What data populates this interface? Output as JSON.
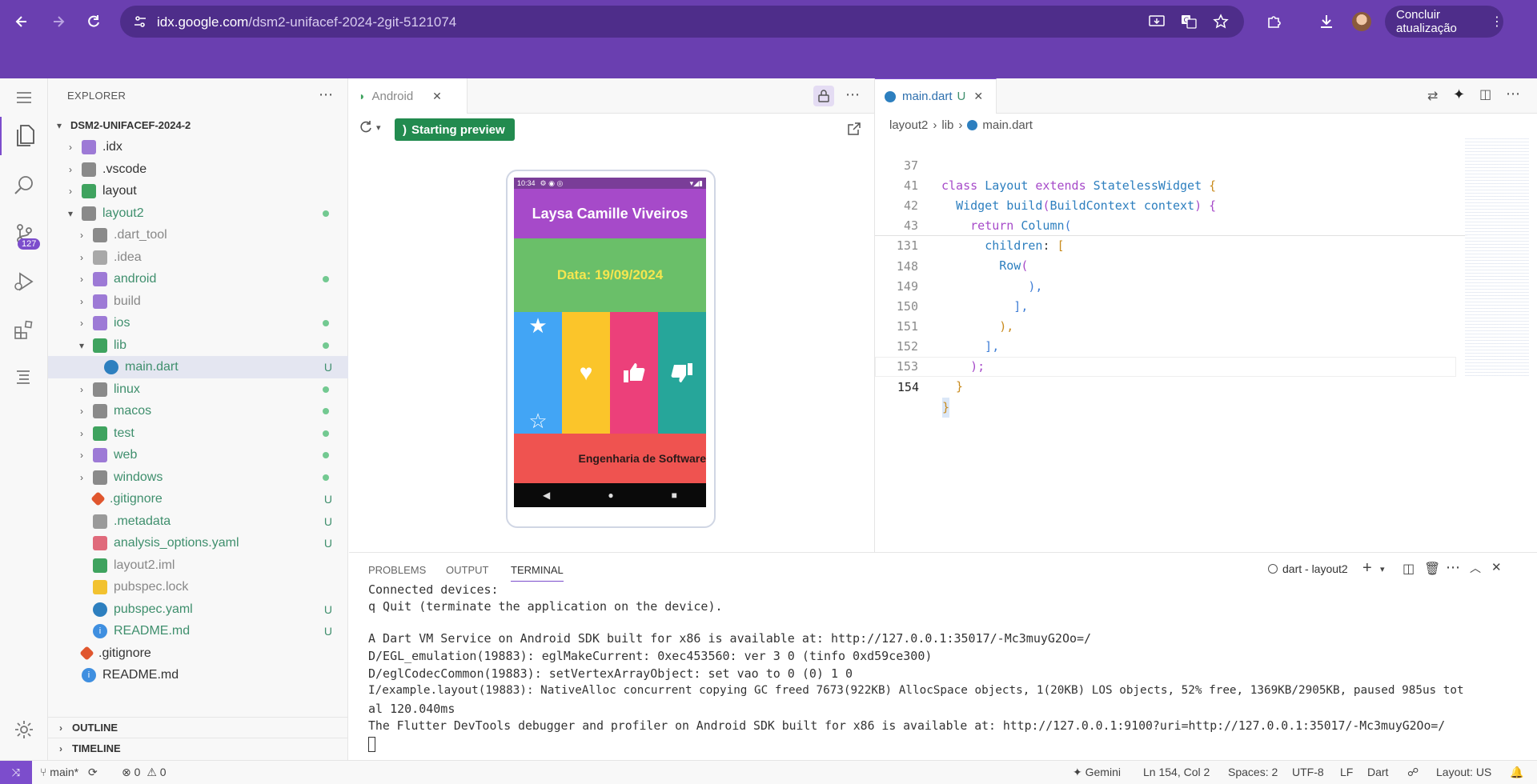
{
  "browser": {
    "url_host": "idx.google.com",
    "url_path": "/dsm2-unifacef-2024-2git-5121074",
    "update_button": "Concluir atualização"
  },
  "activity": {
    "scm_badge": "127"
  },
  "explorer": {
    "title": "EXPLORER",
    "root": "DSM2-UNIFACEF-2024-2",
    "items": [
      {
        "name": ".idx",
        "status": ""
      },
      {
        "name": ".vscode",
        "status": ""
      },
      {
        "name": "layout",
        "status": ""
      },
      {
        "name": "layout2",
        "status": "dot"
      },
      {
        "name": ".dart_tool",
        "status": ""
      },
      {
        "name": ".idea",
        "status": ""
      },
      {
        "name": "android",
        "status": "dot"
      },
      {
        "name": "build",
        "status": ""
      },
      {
        "name": "ios",
        "status": "dot"
      },
      {
        "name": "lib",
        "status": "dot"
      },
      {
        "name": "main.dart",
        "status": "U"
      },
      {
        "name": "linux",
        "status": "dot"
      },
      {
        "name": "macos",
        "status": "dot"
      },
      {
        "name": "test",
        "status": "dot"
      },
      {
        "name": "web",
        "status": "dot"
      },
      {
        "name": "windows",
        "status": "dot"
      },
      {
        "name": ".gitignore",
        "status": "U"
      },
      {
        "name": ".metadata",
        "status": "U"
      },
      {
        "name": "analysis_options.yaml",
        "status": "U"
      },
      {
        "name": "layout2.iml",
        "status": ""
      },
      {
        "name": "pubspec.lock",
        "status": ""
      },
      {
        "name": "pubspec.yaml",
        "status": "U"
      },
      {
        "name": "README.md",
        "status": "U"
      },
      {
        "name": ".gitignore",
        "status": ""
      },
      {
        "name": "README.md",
        "status": ""
      }
    ],
    "status_u": "U",
    "outline": "OUTLINE",
    "timeline": "TIMELINE"
  },
  "preview": {
    "tab": "Android",
    "start_button": "Starting preview",
    "phone": {
      "time": "10:34",
      "header": "Laysa Camille Viveiros",
      "date": "Data: 19/09/2024",
      "footer": "Engenharia de Software"
    }
  },
  "editor": {
    "tab": "main.dart",
    "tab_status": "U",
    "breadcrumb": [
      "layout2",
      "lib",
      "main.dart"
    ],
    "sticky_lines": [
      {
        "n": "37",
        "text": "class Layout extends StatelessWidget {"
      },
      {
        "n": "41",
        "text": "  Widget build(BuildContext context) {"
      },
      {
        "n": "42",
        "text": "    return Column("
      },
      {
        "n": "43",
        "text": "      children: ["
      },
      {
        "n": "131",
        "text": "        Row("
      }
    ],
    "lines": [
      {
        "n": "148",
        "text": "            ),"
      },
      {
        "n": "149",
        "text": "          ],"
      },
      {
        "n": "150",
        "text": "        ),"
      },
      {
        "n": "151",
        "text": "      ],"
      },
      {
        "n": "152",
        "text": "    );"
      },
      {
        "n": "153",
        "text": "  }"
      },
      {
        "n": "154",
        "text": "}"
      }
    ]
  },
  "panel": {
    "tabs": [
      "PROBLEMS",
      "OUTPUT",
      "TERMINAL"
    ],
    "terminal_name": "dart - layout2",
    "lines": [
      "Connected devices:",
      "q Quit (terminate the application on the device).",
      "",
      "A Dart VM Service on Android SDK built for x86 is available at: http://127.0.0.1:35017/-Mc3muyG2Oo=/",
      "D/EGL_emulation(19883): eglMakeCurrent: 0xec453560: ver 3 0 (tinfo 0xd59ce300)",
      "D/eglCodecCommon(19883): setVertexArrayObject: set vao to 0 (0) 1 0",
      "I/example.layout(19883): NativeAlloc concurrent copying GC freed 7673(922KB) AllocSpace objects, 1(20KB) LOS objects, 52% free, 1369KB/2905KB, paused 985us tot",
      "al 120.040ms",
      "The Flutter DevTools debugger and profiler on Android SDK built for x86 is available at: http://127.0.0.1:9100?uri=http://127.0.0.1:35017/-Mc3muyG2Oo=/"
    ]
  },
  "statusbar": {
    "branch": "main*",
    "errors": "0",
    "warnings": "0",
    "gemini": "Gemini",
    "position": "Ln 154, Col 2",
    "spaces": "Spaces: 2",
    "encoding": "UTF-8",
    "eol": "LF",
    "language": "Dart",
    "layout": "Layout: US"
  },
  "colors": {
    "chrome": "#6a3fb0",
    "header": "#a64ac9",
    "date_bg": "#6abf69",
    "blue": "#42a5f5",
    "yellow": "#fbc52a",
    "pink": "#ec407a",
    "teal": "#26a69a",
    "red": "#ef5350"
  }
}
